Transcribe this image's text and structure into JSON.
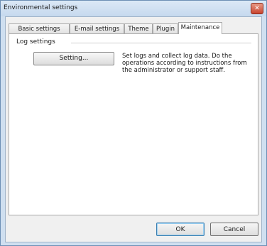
{
  "window": {
    "title": "Environmental settings",
    "close_glyph": "✕"
  },
  "tabs": [
    {
      "label": "Basic settings",
      "active": false
    },
    {
      "label": "E-mail settings",
      "active": false
    },
    {
      "label": "Theme",
      "active": false
    },
    {
      "label": "Plugin",
      "active": false
    },
    {
      "label": "Maintenance",
      "active": true
    }
  ],
  "log_settings": {
    "group_label": "Log settings",
    "button_label": "Setting...",
    "description": "Set logs and collect log data. Do the operations according to instructions from the administrator or support staff."
  },
  "footer": {
    "ok_label": "OK",
    "cancel_label": "Cancel"
  },
  "colors": {
    "frame": "#cfdff0",
    "close_button": "#c9442f"
  }
}
